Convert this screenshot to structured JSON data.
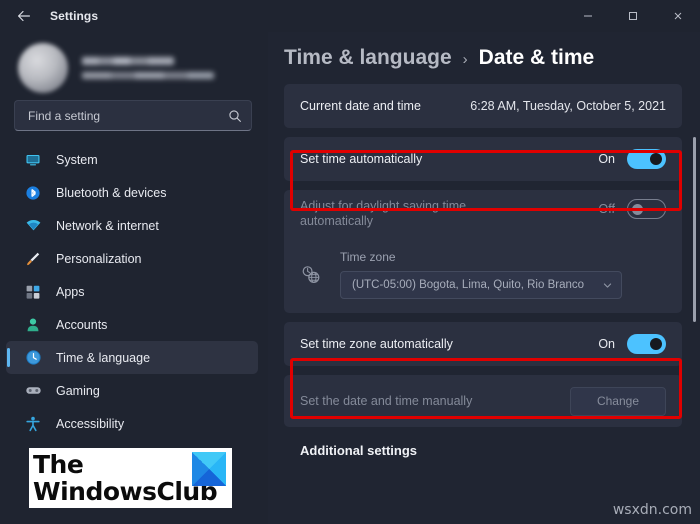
{
  "window": {
    "title": "Settings",
    "back_icon": "back-arrow-icon",
    "minimize_label": "Minimize",
    "maximize_label": "Maximize",
    "close_label": "Close"
  },
  "sidebar": {
    "profile": {
      "name": "",
      "email": "",
      "avatar_label": "User avatar"
    },
    "search": {
      "placeholder": "Find a setting",
      "value": "",
      "icon": "search-icon"
    },
    "items": [
      {
        "label": "System",
        "icon": "monitor-icon",
        "selected": false
      },
      {
        "label": "Bluetooth & devices",
        "icon": "bluetooth-icon",
        "selected": false
      },
      {
        "label": "Network & internet",
        "icon": "wifi-icon",
        "selected": false
      },
      {
        "label": "Personalization",
        "icon": "paintbrush-icon",
        "selected": false
      },
      {
        "label": "Apps",
        "icon": "apps-icon",
        "selected": false
      },
      {
        "label": "Accounts",
        "icon": "person-icon",
        "selected": false
      },
      {
        "label": "Time & language",
        "icon": "clock-icon",
        "selected": true
      },
      {
        "label": "Gaming",
        "icon": "gamepad-icon",
        "selected": false
      },
      {
        "label": "Accessibility",
        "icon": "accessibility-icon",
        "selected": false
      }
    ]
  },
  "breadcrumb": {
    "parent": "Time & language",
    "separator": "›",
    "current": "Date & time"
  },
  "main": {
    "current_datetime": {
      "label": "Current date and time",
      "value": "6:28 AM, Tuesday, October 5, 2021"
    },
    "set_time_automatically": {
      "label": "Set time automatically",
      "state": "On",
      "highlighted": true
    },
    "daylight_saving": {
      "label": "Adjust for daylight saving time automatically",
      "state": "Off",
      "disabled": true
    },
    "time_zone": {
      "icon": "timezone-globe-clock-icon",
      "label": "Time zone",
      "value": "(UTC-05:00) Bogota, Lima, Quito, Rio Branco",
      "chevron": "chevron-down-icon",
      "disabled": true
    },
    "set_time_zone_automatically": {
      "label": "Set time zone automatically",
      "state": "On",
      "highlighted": true
    },
    "set_manually": {
      "label": "Set the date and time manually",
      "button_label": "Change",
      "disabled": true
    },
    "additional_settings_heading": "Additional settings"
  },
  "watermarks": {
    "logo_line1": "The",
    "logo_line2": "WindowsClub",
    "site": "wsxdn.com"
  },
  "colors": {
    "accent": "#4cc2ff",
    "annotation": "#e00000",
    "page_bg": "#202532",
    "card_bg": "#2b3040",
    "sidebar_bg": "#1f2430"
  }
}
